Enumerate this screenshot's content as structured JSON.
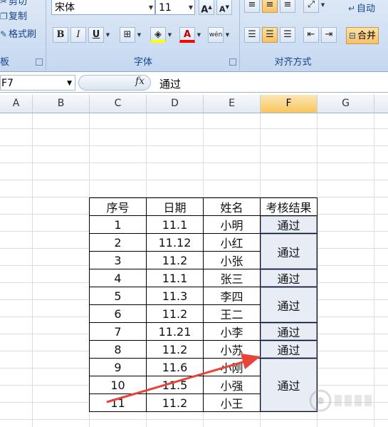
{
  "ribbon": {
    "clipboard": {
      "cut_label": "剪切",
      "copy_label": "复制",
      "format_painter_label": "格式刷",
      "group_label": "板"
    },
    "font": {
      "font_name": "宋体",
      "font_size": "11",
      "grow_icon": "A",
      "shrink_icon": "A",
      "bold": "B",
      "italic": "I",
      "underline": "U",
      "font_color_glyph": "A",
      "phonetic_glyph": "wén",
      "group_label": "字体"
    },
    "alignment": {
      "wrap_label": "自动",
      "merge_label": "合并",
      "group_label": "对齐方式"
    }
  },
  "formula_bar": {
    "name_box": "F7",
    "fx_label": "fx",
    "content": "通过"
  },
  "columns": [
    "A",
    "B",
    "C",
    "D",
    "E",
    "F",
    "G"
  ],
  "selected_column": "F",
  "table": {
    "headers": [
      "序号",
      "日期",
      "姓名",
      "考核结果"
    ],
    "rows": [
      {
        "no": "1",
        "date": "11.1",
        "name": "小明"
      },
      {
        "no": "2",
        "date": "11.12",
        "name": "小红"
      },
      {
        "no": "3",
        "date": "11.2",
        "name": "小张"
      },
      {
        "no": "4",
        "date": "11.1",
        "name": "张三"
      },
      {
        "no": "5",
        "date": "11.3",
        "name": "李四"
      },
      {
        "no": "6",
        "date": "11.2",
        "name": "王二"
      },
      {
        "no": "7",
        "date": "11.21",
        "name": "小李"
      },
      {
        "no": "8",
        "date": "11.2",
        "name": "小苏"
      },
      {
        "no": "9",
        "date": "11.6",
        "name": "小刚"
      },
      {
        "no": "10",
        "date": "11.5",
        "name": "小强"
      },
      {
        "no": "11",
        "date": "11.2",
        "name": "小王"
      }
    ],
    "results": [
      {
        "text": "通过",
        "rowspan": 1
      },
      {
        "text": "通过",
        "rowspan": 2
      },
      {
        "text": "通过",
        "rowspan": 1
      },
      {
        "text": "通过",
        "rowspan": 2
      },
      {
        "text": "通过",
        "rowspan": 1
      },
      {
        "text": "通过",
        "rowspan": 1
      },
      {
        "text": "通过",
        "rowspan": 3
      }
    ]
  },
  "colors": {
    "arrow": "#e8443a",
    "ribbon_label": "#15428b",
    "selected_header": "#f9c65e"
  }
}
